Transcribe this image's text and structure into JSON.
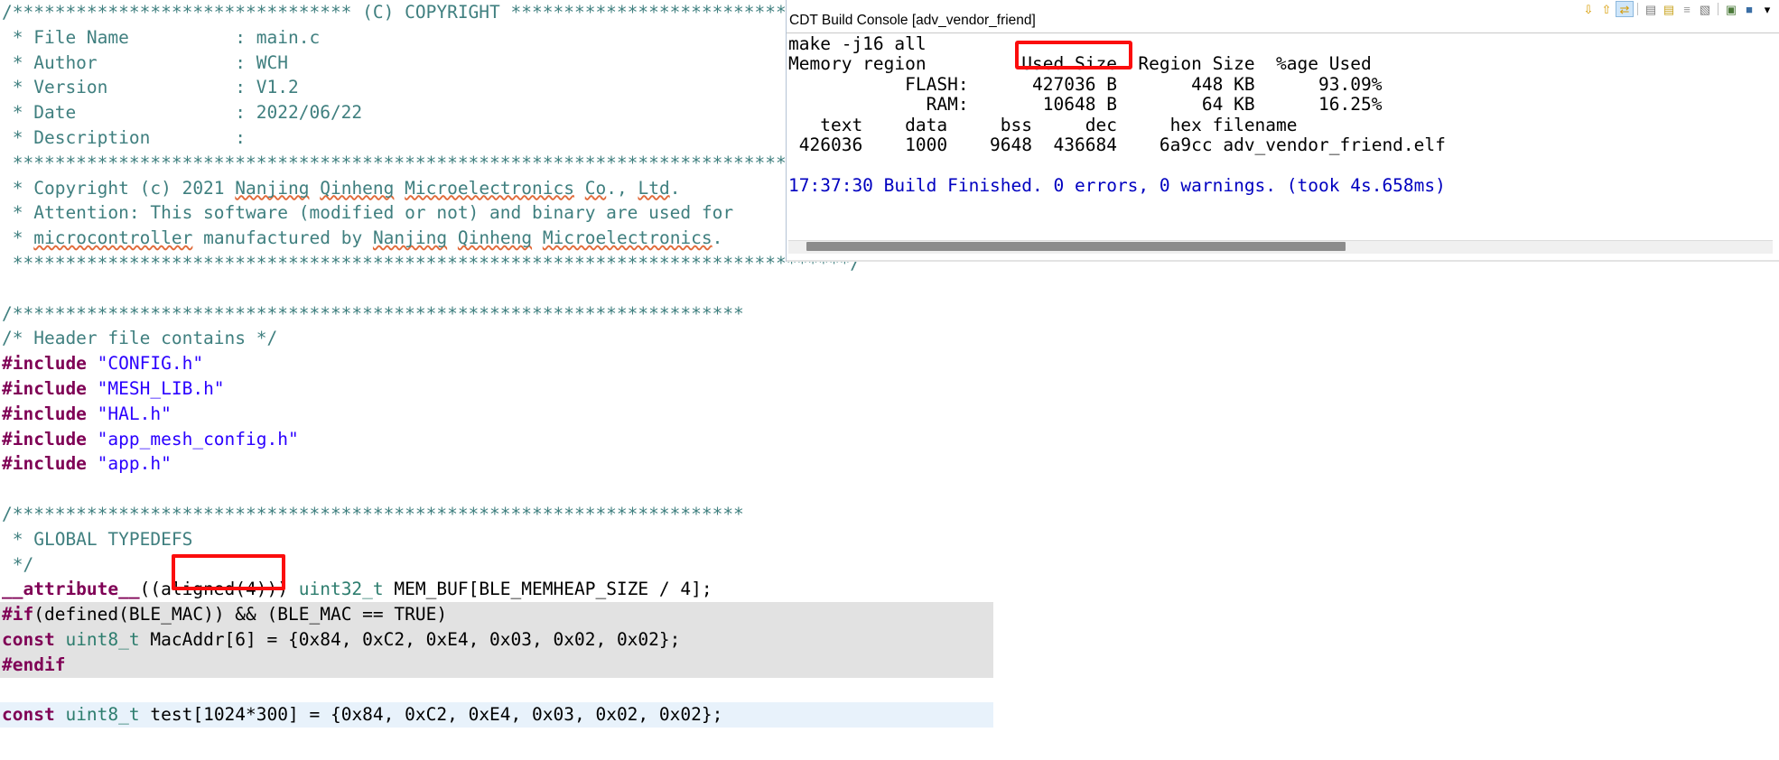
{
  "editor": {
    "lines": [
      {
        "id": "l1",
        "kind": "comment",
        "text": "/******************************** (C) COPYRIGHT *********************************"
      },
      {
        "id": "l2",
        "kind": "comment",
        "text": " * File Name          : main.c"
      },
      {
        "id": "l3",
        "kind": "comment",
        "text": " * Author             : WCH"
      },
      {
        "id": "l4",
        "kind": "comment",
        "text": " * Version            : V1.2"
      },
      {
        "id": "l5",
        "kind": "comment",
        "text": " * Date               : 2022/06/22"
      },
      {
        "id": "l6",
        "kind": "comment",
        "text": " * Description        :"
      },
      {
        "id": "l7",
        "kind": "comment",
        "text": " *******************************************************************************"
      },
      {
        "id": "l8",
        "kind": "comment",
        "text": " * Copyright (c) 2021 Nanjing Qinheng Microelectronics Co., Ltd."
      },
      {
        "id": "l9",
        "kind": "comment",
        "text": " * Attention: This software (modified or not) and binary are used for"
      },
      {
        "id": "l10",
        "kind": "comment",
        "text": " * microcontroller manufactured by Nanjing Qinheng Microelectronics."
      },
      {
        "id": "l11",
        "kind": "comment",
        "text": " *******************************************************************************/"
      },
      {
        "id": "l12",
        "kind": "blank",
        "text": ""
      },
      {
        "id": "l13",
        "kind": "comment",
        "text": "/*********************************************************************"
      },
      {
        "id": "l14",
        "kind": "comment",
        "text": "/* Header file contains */"
      },
      {
        "id": "l15",
        "kind": "include",
        "directive": "#include",
        "target": "\"CONFIG.h\""
      },
      {
        "id": "l16",
        "kind": "include",
        "directive": "#include",
        "target": "\"MESH_LIB.h\""
      },
      {
        "id": "l17",
        "kind": "include",
        "directive": "#include",
        "target": "\"HAL.h\""
      },
      {
        "id": "l18",
        "kind": "include",
        "directive": "#include",
        "target": "\"app_mesh_config.h\""
      },
      {
        "id": "l19",
        "kind": "include",
        "directive": "#include",
        "target": "\"app.h\""
      },
      {
        "id": "l20",
        "kind": "blank",
        "text": ""
      },
      {
        "id": "l21",
        "kind": "comment",
        "text": "/*********************************************************************"
      },
      {
        "id": "l22",
        "kind": "comment",
        "text": " * GLOBAL TYPEDEFS"
      },
      {
        "id": "l23",
        "kind": "comment",
        "text": " */"
      },
      {
        "id": "l24",
        "kind": "attribute",
        "text": "__attribute__((aligned(4))) uint32_t MEM_BUF[BLE_MEMHEAP_SIZE / 4];"
      },
      {
        "id": "l25",
        "kind": "ifdef",
        "text": "#if(defined(BLE_MAC)) && (BLE_MAC == TRUE)"
      },
      {
        "id": "l26",
        "kind": "macaddr",
        "text": "const uint8_t MacAddr[6] = {0x84, 0xC2, 0xE4, 0x03, 0x02, 0x02};"
      },
      {
        "id": "l27",
        "kind": "endif",
        "text": "#endif"
      },
      {
        "id": "l28",
        "kind": "blank",
        "text": ""
      },
      {
        "id": "l29",
        "kind": "testarr",
        "text": "const uint8_t test[1024*300] = {0x84, 0xC2, 0xE4, 0x03, 0x02, 0x02};"
      }
    ],
    "tokens": {
      "include_directive": "#include",
      "const_kw": "const",
      "type_uint8": "uint8_t",
      "type_uint32": "uint32_t",
      "attribute_kw": "__attribute__",
      "attribute_rest": "((aligned(4))) ",
      "attribute_tail": " MEM_BUF[BLE_MEMHEAP_SIZE / 4];",
      "if_kw": "#if",
      "if_rest": "(defined(BLE_MAC)) && (BLE_MAC == TRUE)",
      "endif_kw": "#endif",
      "macaddr_tail": " MacAddr[6] = {0x84, 0xC2, 0xE4, 0x03, 0x02, 0x02};",
      "test_tail": " test[1024*300] = {0x84, 0xC2, 0xE4, 0x03, 0x02, 0x02};"
    },
    "annotation": {
      "name": "red-highlight-box",
      "target": "t[1024*300]"
    },
    "colors": {
      "comment": "#3f7f7f",
      "preprocessor": "#7f0055",
      "string": "#2a00ff",
      "type": "#2d7d6e",
      "plain": "#000000",
      "highlight_gray": "#e2e2e2",
      "highlight_blue": "#e8f2fb",
      "annotation_red": "#fb0d0d",
      "spellcheck": "#e06a3a"
    }
  },
  "console": {
    "tab_title": "CDT Build Console [adv_vendor_friend]",
    "toolbar": [
      {
        "name": "scroll-lock-down-icon",
        "glyph": "⇩",
        "selected": false
      },
      {
        "name": "scroll-lock-up-icon",
        "glyph": "⇧",
        "selected": false
      },
      {
        "name": "pin-console-icon",
        "glyph": "⇄",
        "selected": true
      },
      {
        "name": "separator",
        "glyph": "",
        "selected": false
      },
      {
        "name": "save-console-icon",
        "glyph": "▤",
        "selected": false
      },
      {
        "name": "lock-console-icon",
        "glyph": "▤",
        "selected": false
      },
      {
        "name": "word-wrap-icon",
        "glyph": "≡",
        "selected": false
      },
      {
        "name": "clear-console-icon",
        "glyph": "▧",
        "selected": false
      },
      {
        "name": "separator",
        "glyph": "",
        "selected": false
      },
      {
        "name": "new-console-view-icon",
        "glyph": "▣",
        "selected": false
      },
      {
        "name": "display-selected-console-icon",
        "glyph": "■",
        "selected": false
      },
      {
        "name": "console-menu-dropdown-icon",
        "glyph": "▾",
        "selected": false
      }
    ],
    "output_lines": [
      {
        "id": "c1",
        "text": "make -j16 all",
        "color": "black"
      },
      {
        "id": "c2",
        "text": "Memory region         Used Size  Region Size  %age Used",
        "color": "black"
      },
      {
        "id": "c3",
        "text": "           FLASH:      427036 B       448 KB      93.09%",
        "color": "black"
      },
      {
        "id": "c4",
        "text": "             RAM:       10648 B        64 KB      16.25%",
        "color": "black"
      },
      {
        "id": "c5",
        "text": "   text    data     bss     dec     hex filename",
        "color": "black"
      },
      {
        "id": "c6",
        "text": " 426036    1000    9648  436684    6a9cc adv_vendor_friend.elf",
        "color": "black"
      },
      {
        "id": "c7",
        "text": "",
        "color": "black"
      },
      {
        "id": "c8",
        "text": "17:37:30 Build Finished. 0 errors, 0 warnings. (took 4s.658ms)",
        "color": "blue"
      }
    ],
    "memory_table": {
      "headers": [
        "Memory region",
        "Used Size",
        "Region Size",
        "%age Used"
      ],
      "rows": [
        {
          "region": "FLASH:",
          "used": "427036 B",
          "size": "448 KB",
          "pct": "93.09%"
        },
        {
          "region": "RAM:",
          "used": "10648 B",
          "size": "64 KB",
          "pct": "16.25%"
        }
      ]
    },
    "size_table": {
      "headers": [
        "text",
        "data",
        "bss",
        "dec",
        "hex",
        "filename"
      ],
      "row": [
        "426036",
        "1000",
        "9648",
        "436684",
        "6a9cc",
        "adv_vendor_friend.elf"
      ]
    },
    "build_status": {
      "time": "17:37:30",
      "message": "Build Finished.",
      "errors": "0 errors",
      "warnings": "0 warnings",
      "duration": "(took 4s.658ms)"
    },
    "annotation": {
      "name": "red-highlight-box",
      "target": "427036 B"
    },
    "scrollbar": {
      "name": "horizontal-scrollbar",
      "thumb_pct": 55
    }
  }
}
